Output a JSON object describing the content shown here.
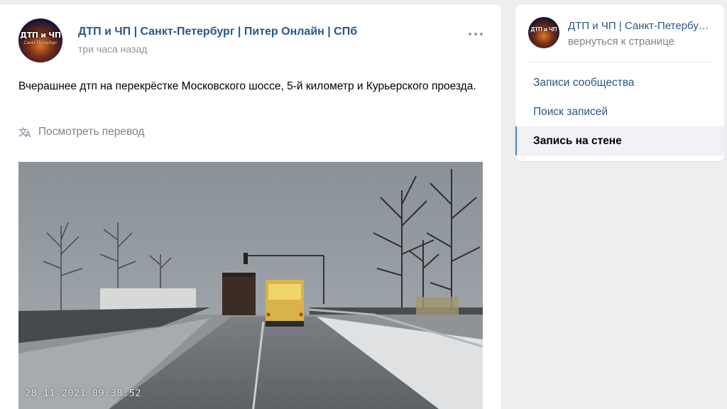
{
  "post": {
    "author": "ДТП и ЧП | Санкт-Петербург | Питер Онлайн | СПб",
    "date": "три часа назад",
    "text": "Вчерашнее дтп на перекрёстке Московского шоссе, 5-й километр и Курьерского проезда.",
    "translate_label": "Посмотреть перевод",
    "avatar_text": "ДТП и ЧП",
    "avatar_subtext": "Санкт-Петербург",
    "photo_timestamp": "28-11-2021 09:38:52",
    "more_icon": "more-horizontal-icon",
    "translate_icon": "translate-icon"
  },
  "sidebar": {
    "title": "ДТП и ЧП | Санкт-Петербург | Питер Онлайн | СПб",
    "back_label": "вернуться к странице",
    "avatar_text": "ДТП и ЧП",
    "items": [
      {
        "label": "Записи сообщества",
        "active": false
      },
      {
        "label": "Поиск записей",
        "active": false
      },
      {
        "label": "Запись на стене",
        "active": true
      }
    ]
  },
  "colors": {
    "link": "#2a5885",
    "muted": "#939393",
    "background": "#edeef0",
    "active_marker": "#5181b8"
  }
}
